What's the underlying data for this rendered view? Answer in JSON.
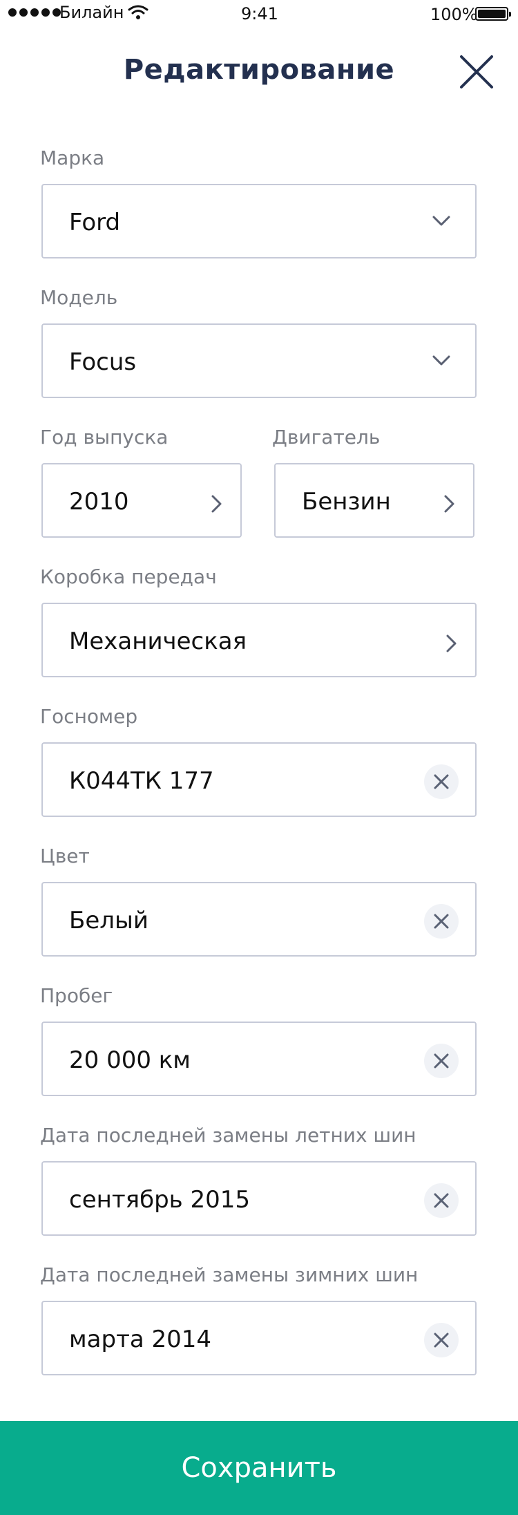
{
  "status_bar": {
    "carrier": "Билайн",
    "time": "9:41",
    "battery": "100%"
  },
  "header": {
    "title": "Редактирование",
    "close_icon": "close-icon"
  },
  "form": {
    "brand": {
      "label": "Марка",
      "value": "Ford",
      "icon": "chevron-down-icon"
    },
    "model": {
      "label": "Модель",
      "value": "Focus",
      "icon": "chevron-down-icon"
    },
    "year": {
      "label": "Год выпуска",
      "value": "2010",
      "icon": "chevron-right-icon"
    },
    "engine": {
      "label": "Двигатель",
      "value": "Бензин",
      "icon": "chevron-right-icon"
    },
    "transmission": {
      "label": "Коробка передач",
      "value": "Механическая",
      "icon": "chevron-right-icon"
    },
    "plate": {
      "label": "Госномер",
      "value": "К044ТК 177",
      "icon": "clear-icon"
    },
    "color": {
      "label": "Цвет",
      "value": "Белый",
      "icon": "clear-icon"
    },
    "mileage": {
      "label": "Пробег",
      "value": "20 000 км",
      "icon": "clear-icon"
    },
    "summer_tires": {
      "label": "Дата последней замены летних шин",
      "value": "сентябрь 2015",
      "icon": "clear-icon"
    },
    "winter_tires": {
      "label": "Дата последней замены зимних шин",
      "value": "марта 2014",
      "icon": "clear-icon"
    }
  },
  "actions": {
    "save_label": "Сохранить"
  },
  "colors": {
    "title": "#23304f",
    "label": "#7b7e85",
    "border": "#c6cad8",
    "accent": "#08ac8d"
  }
}
